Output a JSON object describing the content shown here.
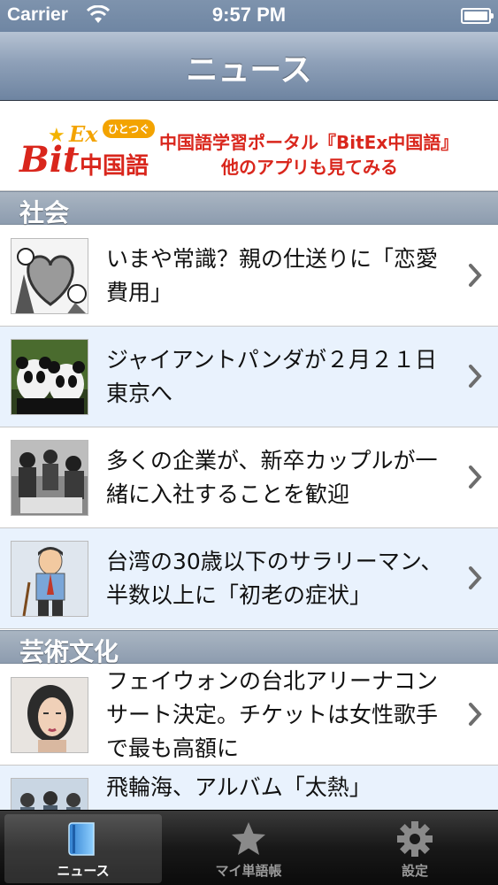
{
  "status_bar": {
    "carrier": "Carrier",
    "time": "9:57 PM"
  },
  "nav": {
    "title": "ニュース"
  },
  "banner": {
    "logo_bit": "Bit",
    "logo_ex": "Ex",
    "logo_bubble": "ひとつぐ",
    "logo_cn": "中国語",
    "line1": "中国語学習ポータル『BitEx中国語』",
    "line2": "他のアプリも見てみる"
  },
  "sections": [
    {
      "title": "社会",
      "rows": [
        {
          "text": "いまや常識？親の仕送りに「恋愛費用」"
        },
        {
          "text": "ジャイアントパンダが２月２１日東京へ"
        },
        {
          "text": "多くの企業が、新卒カップルが一緒に入社することを歓迎"
        },
        {
          "text": "台湾の30歳以下のサラリーマン、半数以上に「初老の症状」"
        }
      ]
    },
    {
      "title": "芸術文化",
      "rows": [
        {
          "text": "フェイウォンの台北アリーナコンサート決定。チケットは女性歌手で最も高額に"
        },
        {
          "text": "飛輪海、アルバム「太熱」"
        }
      ]
    }
  ],
  "tab_bar": {
    "tabs": [
      {
        "label": "ニュース",
        "icon": "book-icon",
        "selected": true
      },
      {
        "label": "マイ単語帳",
        "icon": "star-icon",
        "selected": false
      },
      {
        "label": "設定",
        "icon": "gear-icon",
        "selected": false
      }
    ]
  },
  "colors": {
    "accent": "#d9261c",
    "nav_bar": "#7f92ab",
    "row_alt": "#e9f2fd"
  }
}
